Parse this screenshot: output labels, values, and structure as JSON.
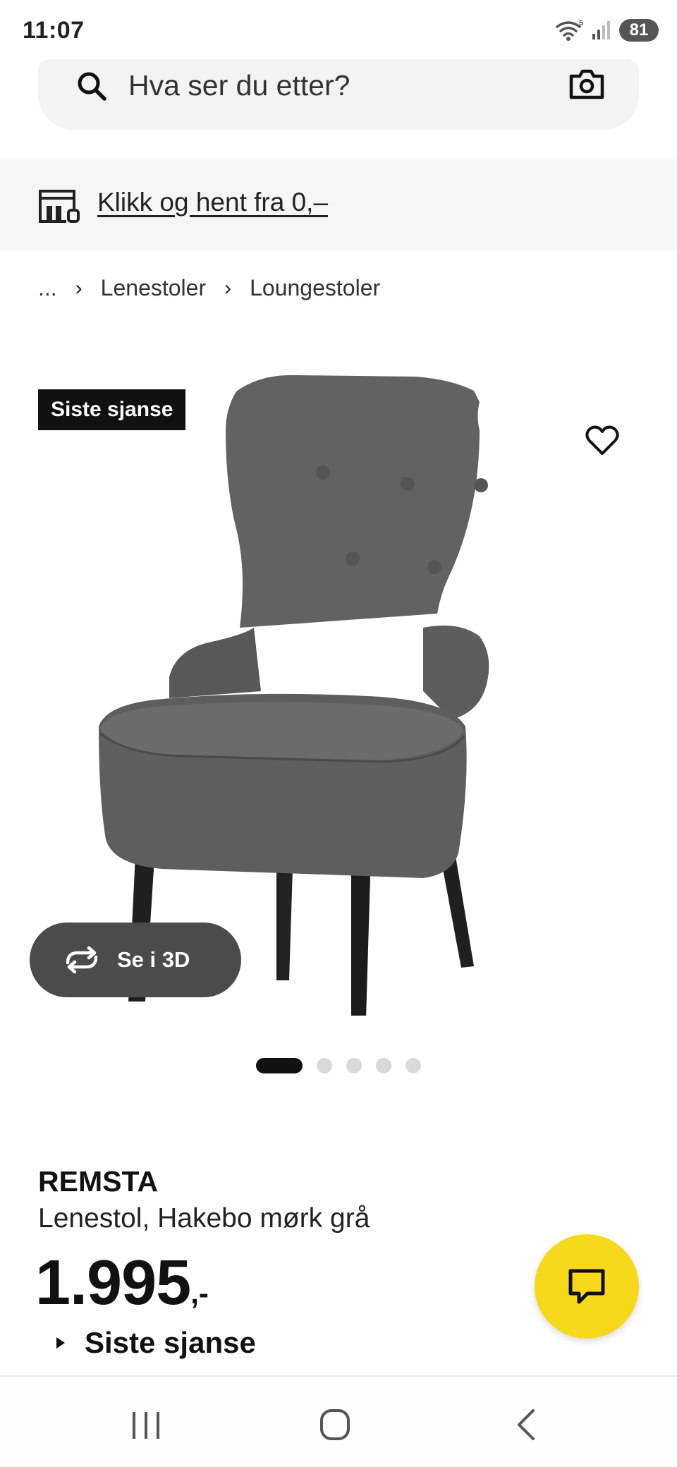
{
  "status_bar": {
    "time": "11:07",
    "wifi_badge": "5",
    "battery": "81"
  },
  "search": {
    "placeholder": "Hva ser du etter?"
  },
  "click_collect": {
    "label": "Klikk og hent fra 0,–"
  },
  "breadcrumb": {
    "items": [
      "...",
      "Lenestoler",
      "Loungestoler"
    ]
  },
  "gallery": {
    "badge": "Siste sjanse",
    "view_3d_label": "Se i 3D",
    "image_count": 5,
    "active_index": 0
  },
  "product": {
    "name": "REMSTA",
    "description": "Lenestol, Hakebo mørk grå",
    "price": "1.995",
    "price_suffix": ",-",
    "sale_label": "Siste sjanse"
  },
  "colors": {
    "accent_yellow": "#f7d91b",
    "badge_black": "#111111",
    "button_grey": "#4b4b4b"
  },
  "icons": {
    "search": "search-icon",
    "camera": "camera-icon",
    "store": "store-icon",
    "heart": "heart-icon",
    "rotate": "rotate-3d-icon",
    "chat": "chat-icon"
  }
}
